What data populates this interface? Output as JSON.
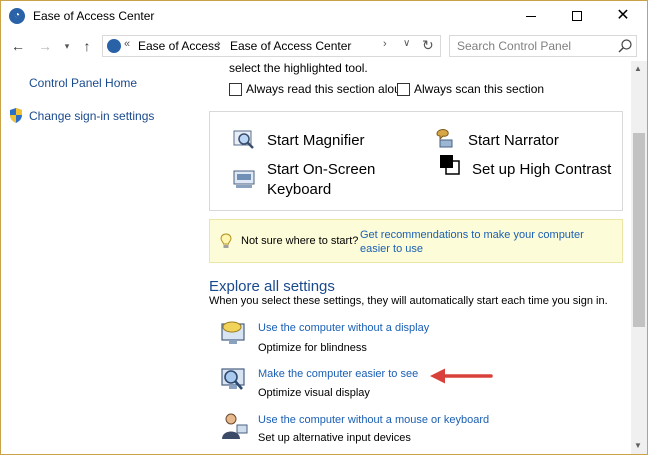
{
  "window": {
    "title": "Ease of Access Center",
    "minimize_label": "—",
    "close_glyph": "✕"
  },
  "nav": {
    "back_glyph": "←",
    "forward_glyph": "→",
    "recent_glyph": "▾",
    "up_glyph": "↑",
    "breadcrumb_sep": "«",
    "breadcrumb_arrow": "›",
    "breadcrumbs": [
      "Ease of Access",
      "Ease of Access Center"
    ],
    "dropdown_glyph": "∨",
    "refresh_glyph": "↻",
    "search_placeholder": "Search Control Panel"
  },
  "sidebar": {
    "home_link": "Control Panel Home",
    "sign_in_link": "Change sign-in settings"
  },
  "main": {
    "scan_text": "select the highlighted tool.",
    "checkbox_read": "Always read this section aloud",
    "checkbox_scan": "Always scan this section",
    "tools": {
      "magnifier": "Start Magnifier",
      "narrator": "Start Narrator",
      "osk_line1": "Start On-Screen",
      "osk_line2": "Keyboard",
      "high_contrast": "Set up High Contrast"
    },
    "tip": {
      "text": "Not sure where to start?",
      "link": "Get recommendations to make your computer easier to use"
    },
    "explore": {
      "title": "Explore all settings",
      "description": "When you select these settings, they will automatically start each time you sign in."
    },
    "settings": [
      {
        "link": "Use the computer without a display",
        "sub": "Optimize for blindness"
      },
      {
        "link": "Make the computer easier to see",
        "sub": "Optimize visual display"
      },
      {
        "link": "Use the computer without a mouse or keyboard",
        "sub": "Set up alternative input devices"
      }
    ]
  },
  "scroll": {
    "up_glyph": "▲",
    "down_glyph": "▼"
  },
  "colors": {
    "link": "#1a5fb4",
    "window_border": "#c9a24a",
    "tip_background": "#fdfcd8",
    "annotation_arrow": "#d9403a"
  }
}
